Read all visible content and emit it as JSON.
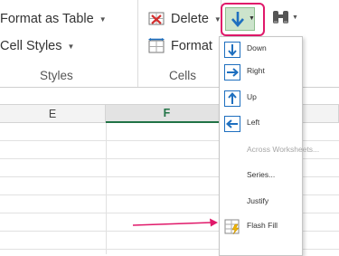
{
  "ribbon": {
    "format_as_table": "Format as Table",
    "cell_styles": "Cell Styles",
    "delete": "Delete",
    "format": "Format",
    "styles_group": "Styles",
    "cells_group": "Cells"
  },
  "columns": [
    "E",
    "F"
  ],
  "fill_menu": {
    "items": [
      {
        "label": "Down",
        "enabled": true
      },
      {
        "label": "Right",
        "enabled": true
      },
      {
        "label": "Up",
        "enabled": true
      },
      {
        "label": "Left",
        "enabled": true
      },
      {
        "label": "Across Worksheets...",
        "enabled": false
      },
      {
        "label": "Series...",
        "enabled": true
      },
      {
        "label": "Justify",
        "enabled": true
      },
      {
        "label": "Flash Fill",
        "enabled": true
      }
    ]
  },
  "colors": {
    "accent_green": "#217346",
    "highlight_pink": "#e0196a",
    "icon_blue": "#1e6fbf"
  }
}
